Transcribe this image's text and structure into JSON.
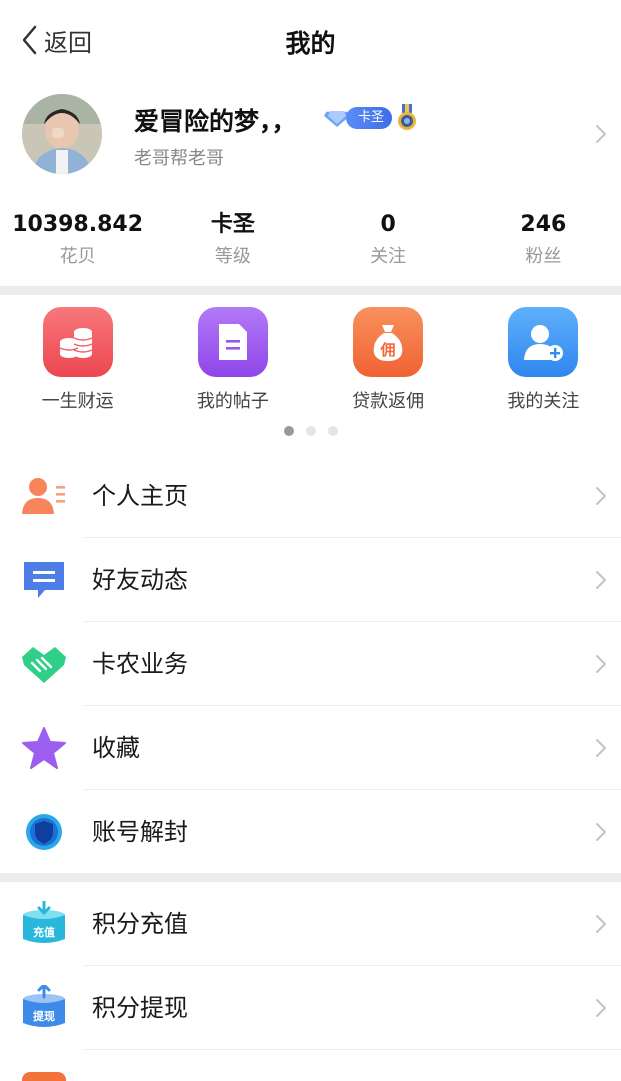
{
  "nav": {
    "back_label": "返回",
    "title": "我的"
  },
  "profile": {
    "username": "爱冒险的梦，，",
    "level_badge": "卡圣",
    "subtitle": "老哥帮老哥"
  },
  "stats": [
    {
      "value": "10398.842",
      "label": "花贝"
    },
    {
      "value": "卡圣",
      "label": "等级"
    },
    {
      "value": "0",
      "label": "关注"
    },
    {
      "value": "246",
      "label": "粉丝"
    }
  ],
  "quick_grid": [
    {
      "label": "一生财运",
      "icon": "coins-icon",
      "color": "#f0555b"
    },
    {
      "label": "我的帖子",
      "icon": "document-icon",
      "color": "#a35cf0"
    },
    {
      "label": "贷款返佣",
      "icon": "money-bag-icon",
      "color": "#f4743b"
    },
    {
      "label": "我的关注",
      "icon": "add-user-icon",
      "color": "#3b93f2"
    }
  ],
  "menu_group_1": [
    {
      "label": "个人主页",
      "icon": "profile-card-icon"
    },
    {
      "label": "好友动态",
      "icon": "message-icon"
    },
    {
      "label": "卡农业务",
      "icon": "handshake-icon"
    },
    {
      "label": "收藏",
      "icon": "star-icon"
    },
    {
      "label": "账号解封",
      "icon": "shield-icon"
    }
  ],
  "menu_group_2": [
    {
      "label": "积分充值",
      "icon": "recharge-box-icon",
      "icon_text": "充值"
    },
    {
      "label": "积分提现",
      "icon": "withdraw-box-icon",
      "icon_text": "提现"
    }
  ],
  "colors": {
    "accent": "#3e6ce8",
    "divider": "#ececec"
  }
}
